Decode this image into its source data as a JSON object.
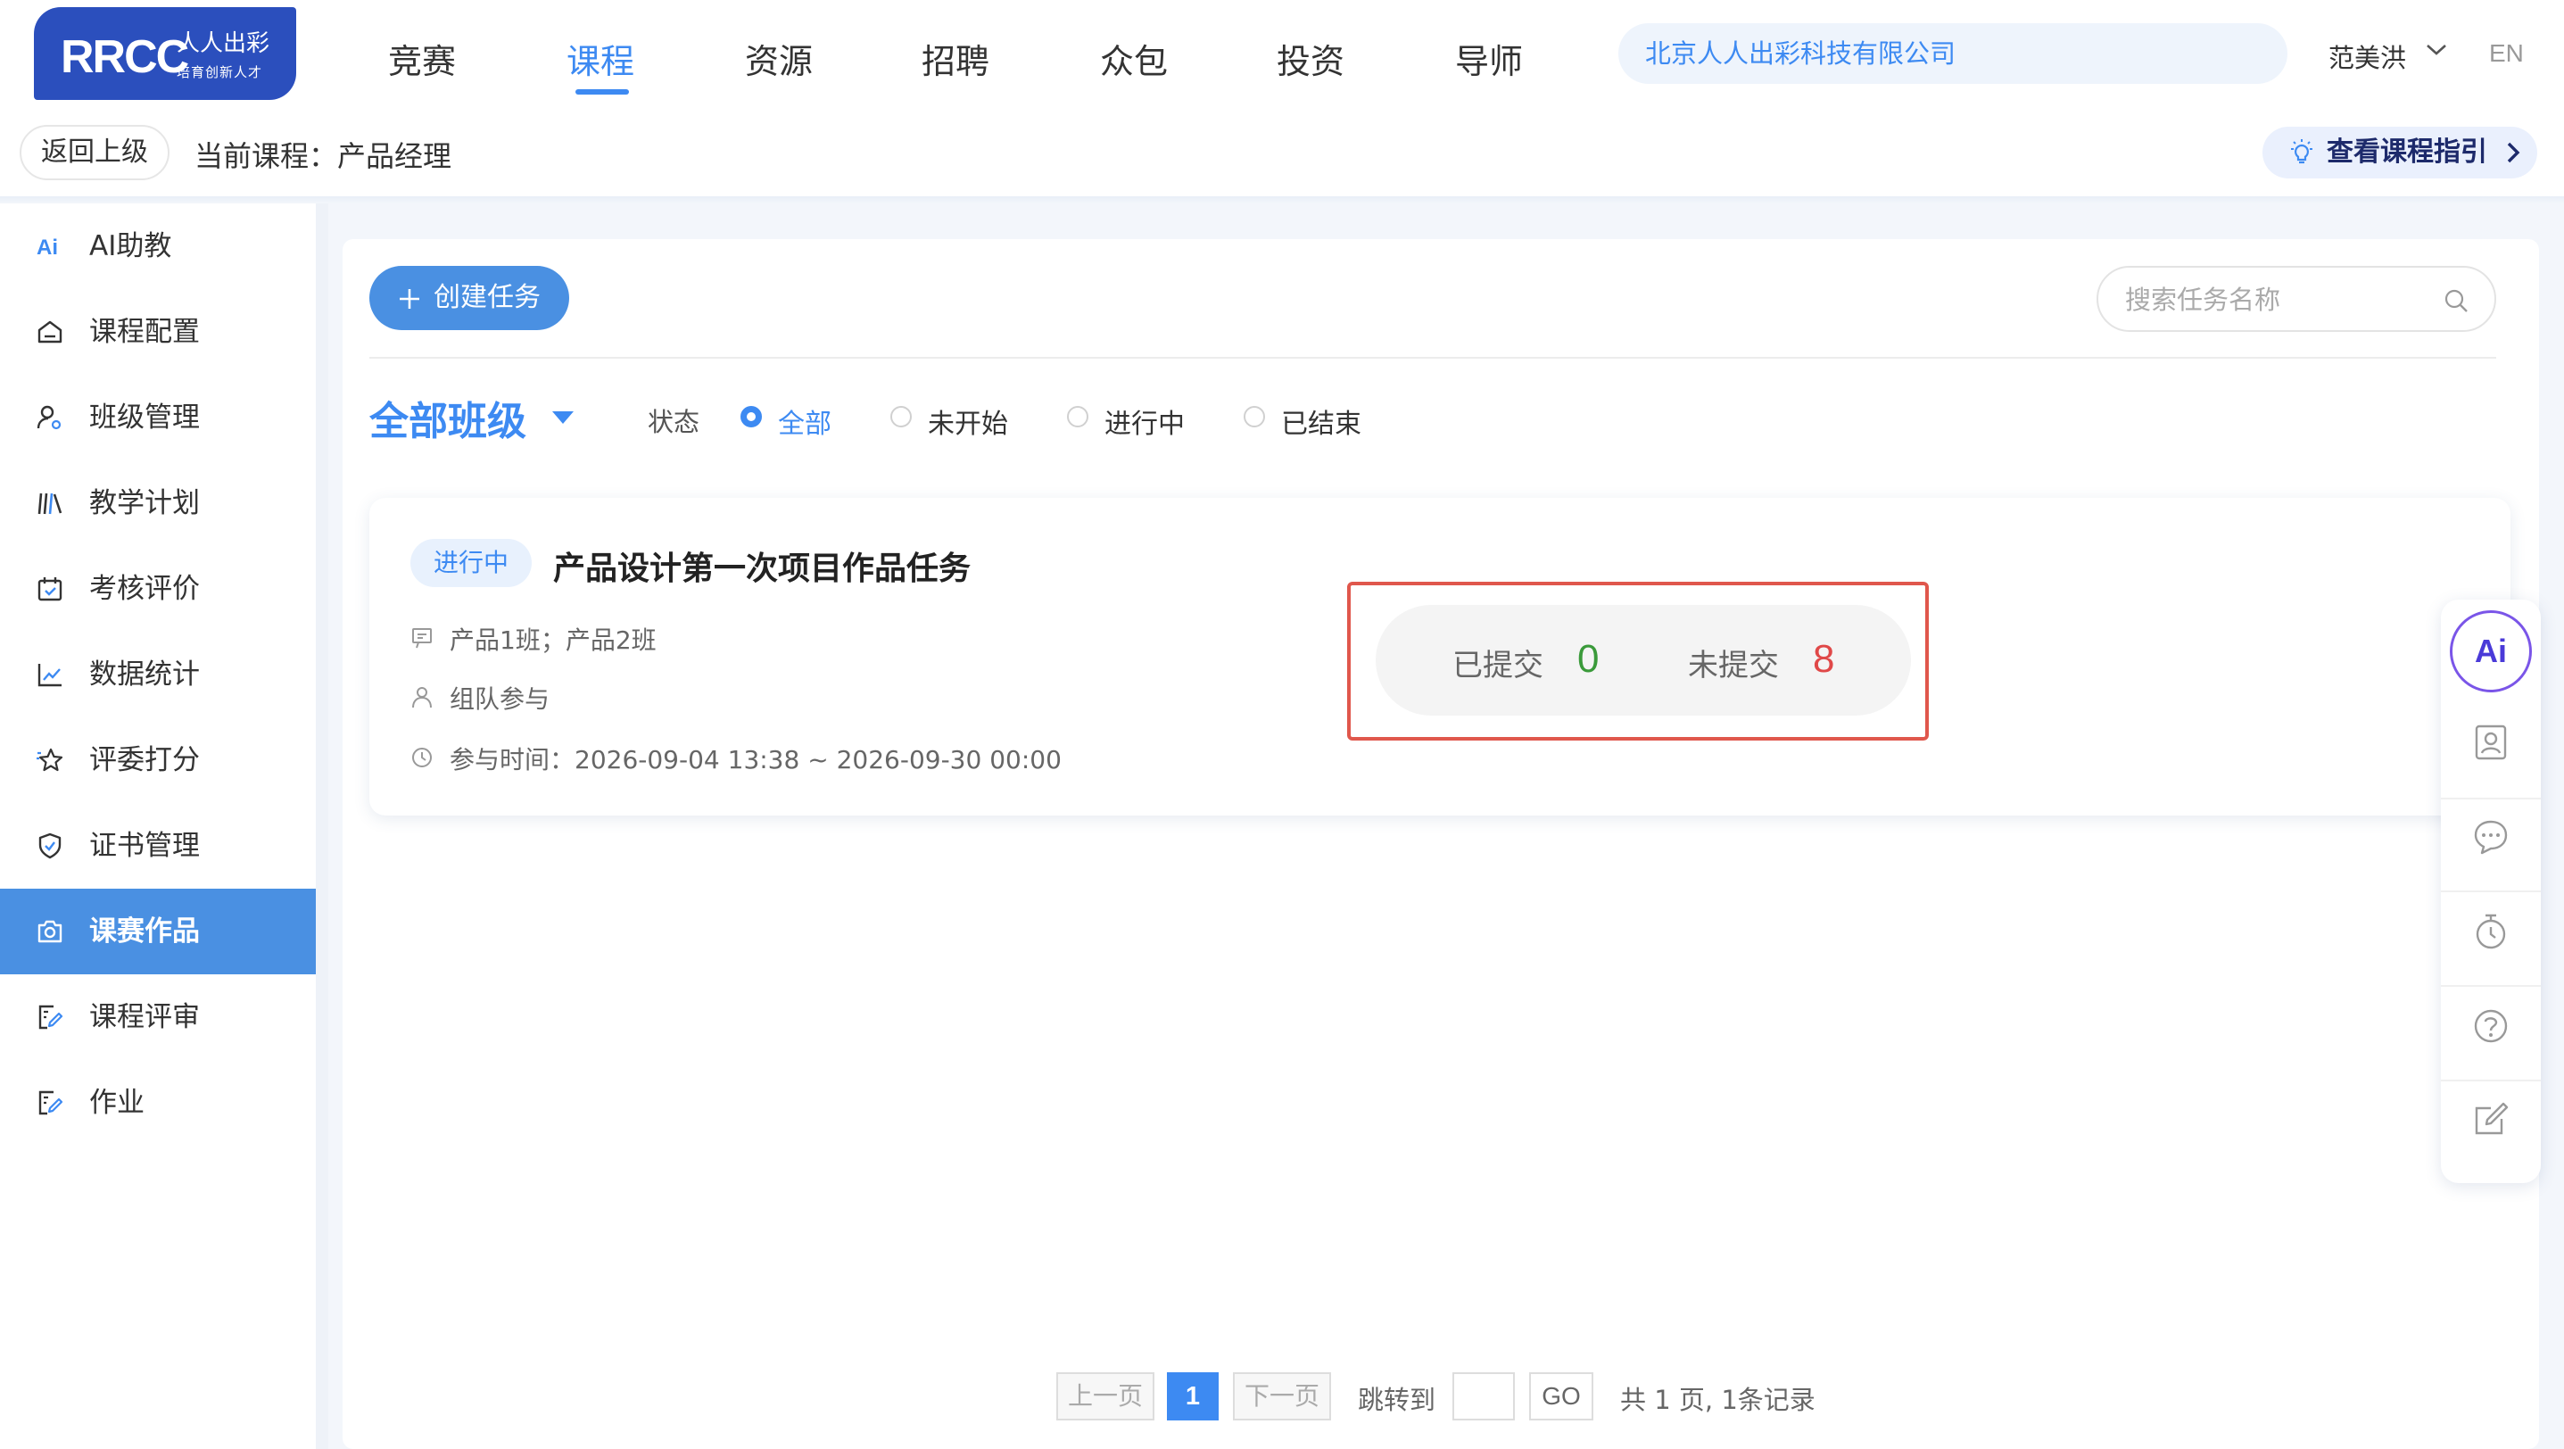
{
  "logo": {
    "brand": "RRCC",
    "cn_name": "人人出彩",
    "slogan": "培育创新人才"
  },
  "nav": {
    "items": [
      {
        "label": "竞赛",
        "active": false
      },
      {
        "label": "课程",
        "active": true
      },
      {
        "label": "资源",
        "active": false
      },
      {
        "label": "招聘",
        "active": false
      },
      {
        "label": "众包",
        "active": false
      },
      {
        "label": "投资",
        "active": false
      },
      {
        "label": "导师",
        "active": false
      }
    ]
  },
  "company": "北京人人出彩科技有限公司",
  "user": {
    "name": "范美洪",
    "lang": "EN"
  },
  "subheader": {
    "back": "返回上级",
    "current_course": "当前课程：产品经理",
    "guide": "查看课程指引"
  },
  "sidebar": {
    "items": [
      {
        "label": "AI助教",
        "icon": "ai-icon"
      },
      {
        "label": "课程配置",
        "icon": "home-icon"
      },
      {
        "label": "班级管理",
        "icon": "user-gear-icon"
      },
      {
        "label": "教学计划",
        "icon": "books-icon"
      },
      {
        "label": "考核评价",
        "icon": "calendar-check-icon"
      },
      {
        "label": "数据统计",
        "icon": "line-chart-icon"
      },
      {
        "label": "评委打分",
        "icon": "star-icon"
      },
      {
        "label": "证书管理",
        "icon": "shield-check-icon"
      },
      {
        "label": "课赛作品",
        "icon": "camera-icon",
        "active": true
      },
      {
        "label": "课程评审",
        "icon": "edit-doc-icon"
      },
      {
        "label": "作业",
        "icon": "edit-doc-icon"
      }
    ]
  },
  "toolbar": {
    "create": "创建任务",
    "search_placeholder": "搜索任务名称"
  },
  "filter": {
    "class": "全部班级",
    "status_label": "状态",
    "options": [
      {
        "label": "全部",
        "selected": true
      },
      {
        "label": "未开始",
        "selected": false
      },
      {
        "label": "进行中",
        "selected": false
      },
      {
        "label": "已结束",
        "selected": false
      }
    ]
  },
  "task": {
    "tag": "进行中",
    "title": "产品设计第一次项目作品任务",
    "classes": "产品1班；产品2班",
    "mode": "组队参与",
    "time": "参与时间：2026-09-04 13:38 ~ 2026-09-30 00:00",
    "submitted_label": "已提交",
    "submitted": "0",
    "unsubmitted_label": "未提交",
    "unsubmitted": "8"
  },
  "right_tools": {
    "ai": "Ai",
    "items": [
      "contact-card-icon",
      "chat-icon",
      "timer-icon",
      "help-icon",
      "edit-icon"
    ]
  },
  "pagination": {
    "prev": "上一页",
    "current": "1",
    "next": "下一页",
    "jump": "跳转到",
    "go": "GO",
    "summary": "共 1 页, 1条记录"
  },
  "colors": {
    "accent": "#3d8af2",
    "sidebar_active": "#4a90e2",
    "highlight_border": "#e0574c",
    "submitted": "#3a9a3a",
    "unsubmitted": "#e04848"
  }
}
